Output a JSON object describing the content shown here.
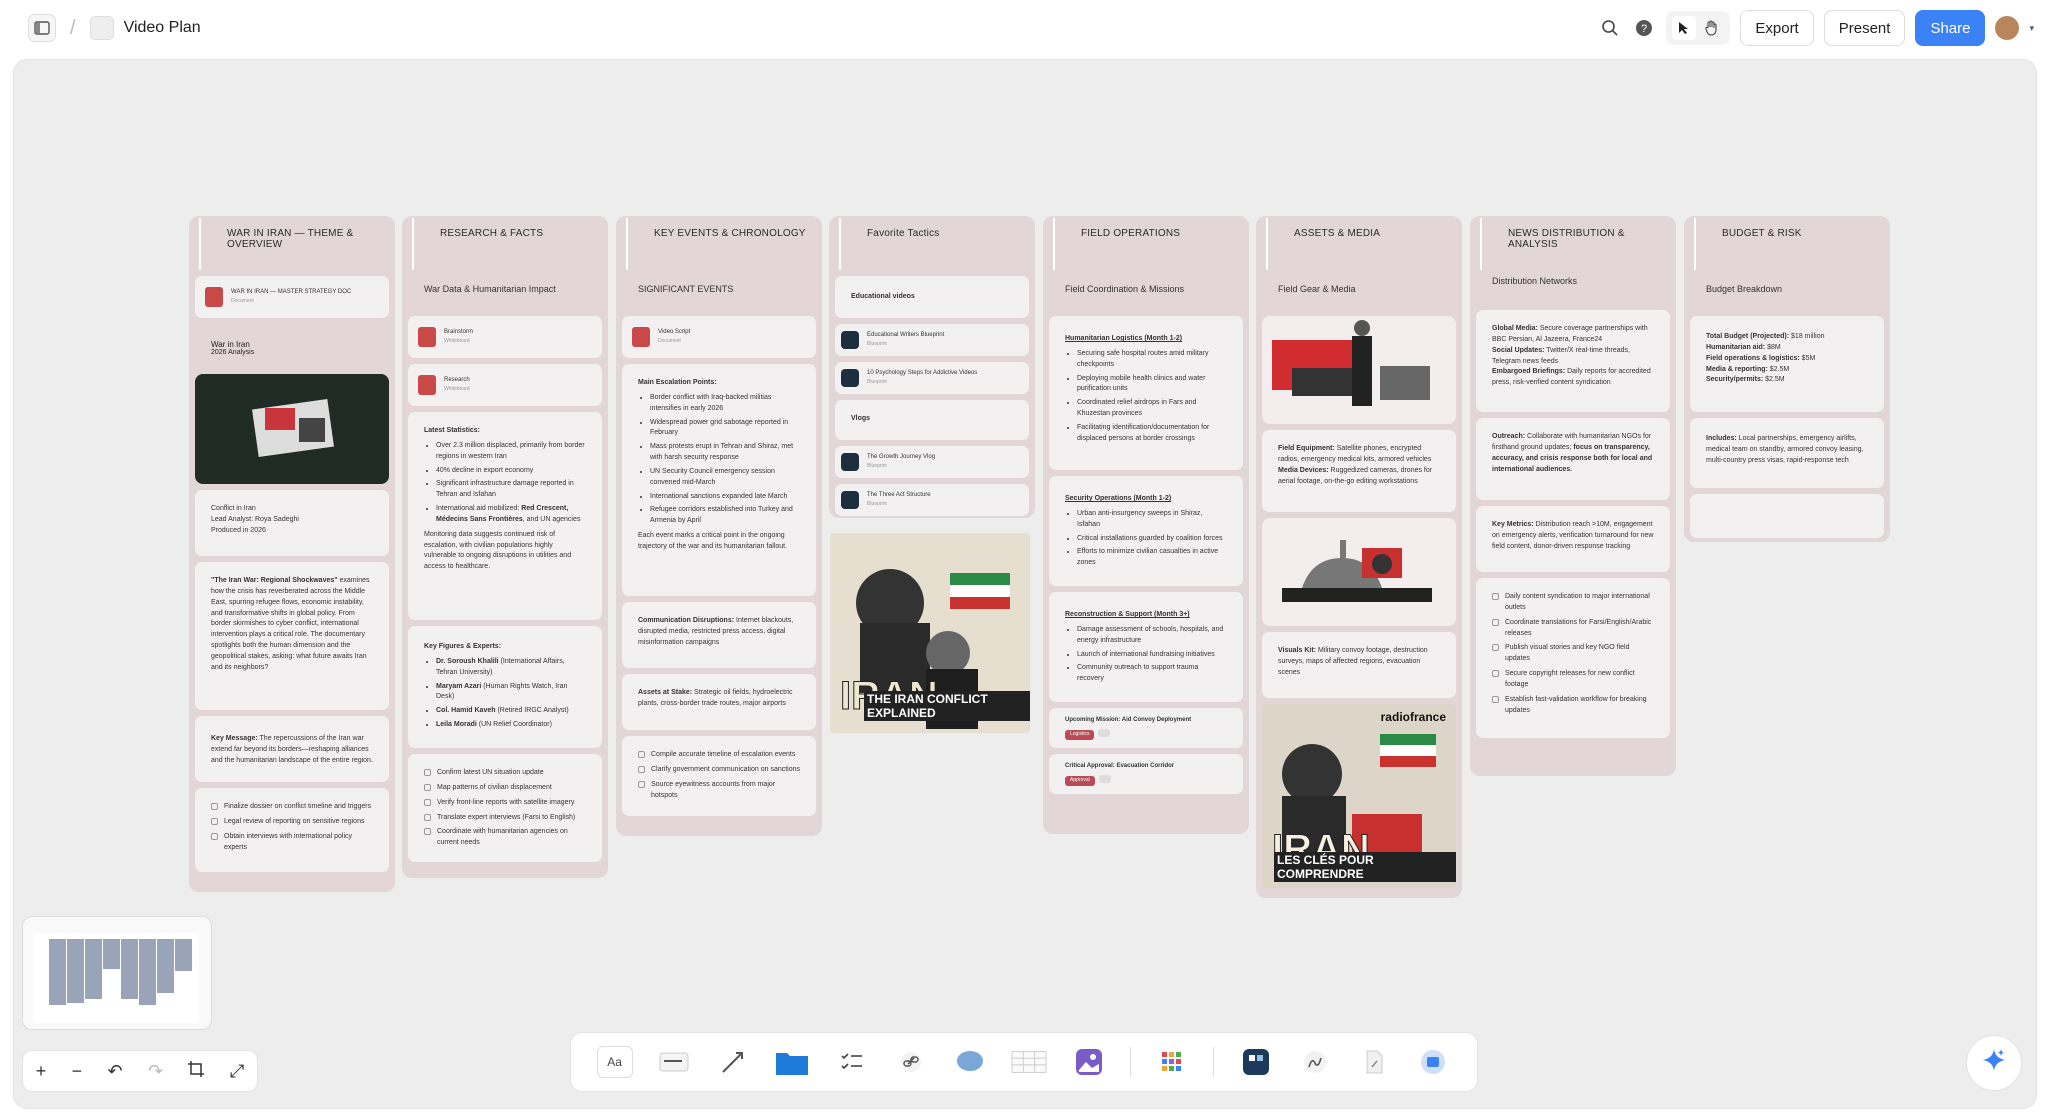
{
  "topbar": {
    "doc_title": "Video Plan",
    "export": "Export",
    "present": "Present",
    "share": "Share",
    "accent": "#3b82f6"
  },
  "columns": [
    {
      "title": "WAR IN IRAN — THEME & OVERVIEW",
      "doc_name": "WAR IN IRAN — MASTER STRATEGY DOC",
      "doc_type": "Document",
      "sub1": "War in Iran",
      "sub2": "2026 Analysis",
      "conflict_title": "Conflict in Iran",
      "conflict_analyst": "Lead Analyst: Roya Sadeghi",
      "conflict_year": "Produced in 2026",
      "lead_bold": "\"The Iran War: Regional Shockwaves\"",
      "lead_rest": " examines how the crisis has reverberated across the Middle East, spurring refugee flows, economic instability, and transformative shifts in global policy. From border skirmishes to cyber conflict, international intervention plays a critical role. The documentary spotlights both the human dimension and the geopolitical stakes, asking: what future awaits Iran and its neighbors?",
      "key_bold": "Key Message:",
      "key_rest": " The repercussions of the Iran war extend far beyond its borders—reshaping alliances and the humanitarian landscape of the entire region.",
      "tasks": [
        "Finalize dossier on conflict timeline and triggers",
        "Legal review of reporting on sensitive regions",
        "Obtain interviews with international policy experts"
      ]
    },
    {
      "title": "RESEARCH & FACTS",
      "subtitle": "War Data & Humanitarian Impact",
      "files": [
        {
          "name": "Brainstorm",
          "type": "Whiteboard"
        },
        {
          "name": "Research",
          "type": "Whiteboard"
        }
      ],
      "stats_title": "Latest Statistics:",
      "stats": [
        "Over 2.3 million displaced, primarily from border regions in western Iran",
        "40% decline in export economy",
        "Significant infrastructure damage reported in Tehran and Isfahan"
      ],
      "aid_pre": "International aid mobilized: ",
      "aid_bold": "Red Crescent, Médecins Sans Frontières",
      "aid_post": ", and UN agencies",
      "monitor": "Monitoring data suggests continued risk of escalation, with civilian populations highly vulnerable to ongoing disruptions in utilities and access to healthcare.",
      "figures_title": "Key Figures & Experts:",
      "figures": [
        {
          "name": "Dr. Soroush Khalili",
          "role": " (International Affairs, Tehran University)"
        },
        {
          "name": "Maryam Azari",
          "role": " (Human Rights Watch, Iran Desk)"
        },
        {
          "name": "Col. Hamid Kaveh",
          "role": " (Retired IRGC Analyst)"
        },
        {
          "name": "Leila Moradi",
          "role": " (UN Relief Coordinator)"
        }
      ],
      "tasks": [
        "Confirm latest UN situation update",
        "Map patterns of civilian displacement",
        "Verify front-line reports with satellite imagery",
        "Translate expert interviews (Farsi to English)",
        "Coordinate with humanitarian agencies on current needs"
      ]
    },
    {
      "title": "KEY EVENTS & CHRONOLOGY",
      "subtitle": "SIGNIFICANT EVENTS",
      "file": {
        "name": "Video Script",
        "type": "Document"
      },
      "esc_title": "Main Escalation Points:",
      "esc": [
        "Border conflict with Iraq-backed militias intensifies in early 2026",
        "Widespread power grid sabotage reported in February",
        "Mass protests erupt in Tehran and Shiraz, met with harsh security response",
        "UN Security Council emergency session convened mid-March",
        "International sanctions expanded late March",
        "Refugee corridors established into Turkey and Armenia by April"
      ],
      "esc_note": "Each event marks a critical point in the ongoing trajectory of the war and its humanitarian fallout.",
      "comm_bold": "Communication Disruptions:",
      "comm_rest": " Internet blackouts, disrupted media, restricted press access, digital misinformation campaigns",
      "assets_bold": "Assets at Stake:",
      "assets_rest": " Strategic oil fields, hydroelectric plants, cross-border trade routes, major airports",
      "tasks": [
        "Compile accurate timeline of escalation events",
        "Clarify government communication on sanctions",
        "Source eyewitness accounts from major hotspots"
      ]
    },
    {
      "title": "Favorite Tactics",
      "group1": "Educational videos",
      "g1": [
        {
          "name": "Educational Writers Blueprint",
          "type": "Blueprint"
        },
        {
          "name": "10 Psychology Steps for Addictive Videos",
          "type": "Blueprint"
        }
      ],
      "group2": "Vlogs",
      "g2": [
        {
          "name": "The Growth Journey Vlog",
          "type": "Blueprint"
        },
        {
          "name": "The Three Act Structure",
          "type": "Blueprint"
        }
      ],
      "poster_title": "IRAN",
      "poster_sub": "THE IRAN CONFLICT EXPLAINED"
    },
    {
      "title": "FIELD OPERATIONS",
      "subtitle": "Field Coordination & Missions",
      "hum_title": "Humanitarian Logistics (Month 1-2)",
      "hum": [
        "Securing safe hospital routes amid military checkpoints",
        "Deploying mobile health clinics and water purification units",
        "Coordinated relief airdrops in Fars and Khuzestan provinces",
        "Facilitating identification/documentation for displaced persons at border crossings"
      ],
      "sec_title": "Security Operations (Month 1-2)",
      "sec": [
        "Urban anti-insurgency sweeps in Shiraz, Isfahan",
        "Critical installations guarded by coalition forces",
        "Efforts to minimize civilian casualties in active zones"
      ],
      "rec_title": "Reconstruction & Support (Month 3+)",
      "rec": [
        "Damage assessment of schools, hospitals, and energy infrastructure",
        "Launch of international fundraising initiatives",
        "Community outreach to support trauma recovery"
      ],
      "m1_title": "Upcoming Mission: Aid Convoy Deployment",
      "m1_tag": "Logistics",
      "m2_title": "Critical Approval: Evacuation Corridor",
      "m2_tag": "Approval"
    },
    {
      "title": "ASSETS & MEDIA",
      "subtitle": "Field Gear & Media",
      "eq_bold": "Field Equipment:",
      "eq_rest": " Satellite phones, encrypted radios, emergency medical kits, armored vehicles",
      "md_bold": "Media Devices:",
      "md_rest": " Ruggedized cameras, drones for aerial footage, on-the-go editing workstations",
      "vk_bold": "Visuals Kit:",
      "vk_rest": " Military convoy footage, destruction surveys, maps of affected regions, evacuation scenes",
      "poster_brand": "radiofrance",
      "poster_title": "IRAN",
      "poster_sub": "LES CLÉS POUR COMPRENDRE"
    },
    {
      "title": "NEWS DISTRIBUTION & ANALYSIS",
      "subtitle": "Distribution Networks",
      "dist": [
        {
          "b": "Global Media:",
          "t": " Secure coverage partnerships with BBC Persian, Al Jazeera, France24"
        },
        {
          "b": "Social Updates:",
          "t": " Twitter/X real-time threads, Telegram news feeds"
        },
        {
          "b": "Embargoed Briefings:",
          "t": " Daily reports for accredited press, risk-verified content syndication"
        }
      ],
      "out_bold": "Outreach:",
      "out_rest": " Collaborate with humanitarian NGOs for firsthand ground updates; ",
      "out_bold2": "focus on transparency, accuracy, and crisis response both for local and international audiences.",
      "km_bold": "Key Metrics:",
      "km_rest": " Distribution reach >10M, engagement on emergency alerts, verification turnaround for new field content, donor-driven response tracking",
      "tasks": [
        "Daily content syndication to major international outlets",
        "Coordinate translations for Farsi/English/Arabic releases",
        "Publish visual stories and key NGO field updates",
        "Secure copyright releases for new conflict footage",
        "Establish fast-validation workflow for breaking updates"
      ]
    },
    {
      "title": "BUDGET & RISK",
      "subtitle": "Budget Breakdown",
      "budget": [
        {
          "b": "Total Budget (Projected):",
          "t": " $18 million"
        },
        {
          "b": "Humanitarian aid:",
          "t": " $8M"
        },
        {
          "b": "Field operations & logistics:",
          "t": " $5M"
        },
        {
          "b": "Media & reporting:",
          "t": " $2.5M"
        },
        {
          "b": "Security/permits:",
          "t": " $2.5M"
        }
      ],
      "inc_bold": "Includes:",
      "inc_rest": " Local partnerships, emergency airlifts, medical team on standby, armored convoy leasing, multi-country press visas, rapid-response tech"
    }
  ],
  "dock": {
    "text_tool": "Aa"
  }
}
